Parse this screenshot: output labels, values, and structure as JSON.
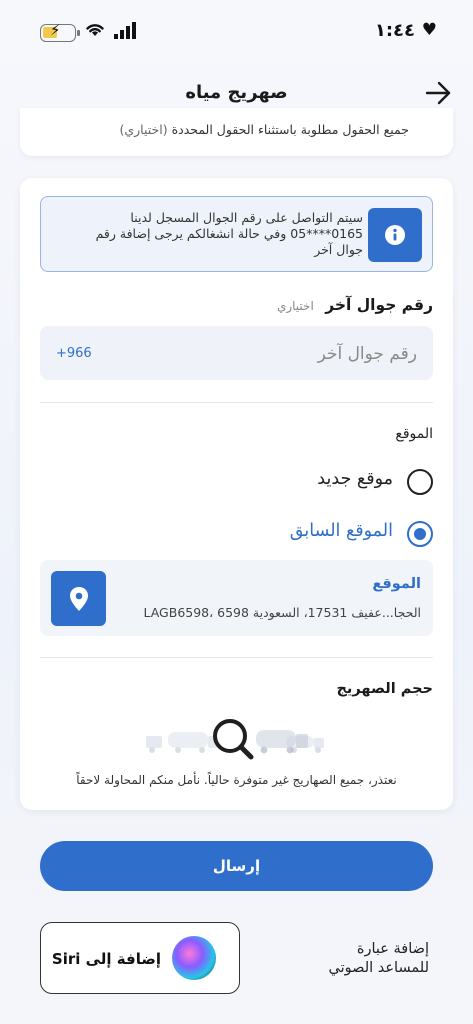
{
  "status_bar": {
    "time": "١:٤٤",
    "heart": "♥",
    "bolt": "⚡"
  },
  "header": {
    "title": "صهريج مياه"
  },
  "notice": {
    "required_text": "جميع الحقول مطلوبة باستثناء الحقول المحددة",
    "optional_text": "(اختياري)"
  },
  "info": {
    "message": "سيتم التواصل على رقم الجوال المسجل لدينا 0165****05 وفي حالة انشغالكم يرجى إضافة رقم جوال آخر"
  },
  "phone": {
    "label": "رقم جوال آخر",
    "optional": "اختياري",
    "placeholder": "رقم جوال آخر",
    "country_code": "+966"
  },
  "location": {
    "label": "الموقع",
    "options": [
      {
        "label": "موقع جديد",
        "selected": false
      },
      {
        "label": "الموقع السابق",
        "selected": true
      }
    ],
    "card_title": "الموقع",
    "address": "الحجا...عفيف 17531، السعودية 6598 ،LAGB6598"
  },
  "tank_size": {
    "label": "حجم الصهريج",
    "unavailable_message": "نعتذر، جميع الصهاريج غير متوفرة حالياً. نأمل منكم المحاولة لاحقاً"
  },
  "actions": {
    "submit_label": "إرسال"
  },
  "siri": {
    "button_label": "إضافة إلى Siri",
    "description": "إضافة عبارة للمساعد الصوتي"
  },
  "colors": {
    "accent": "#2f6fcb",
    "background": "#f4f6fb"
  }
}
